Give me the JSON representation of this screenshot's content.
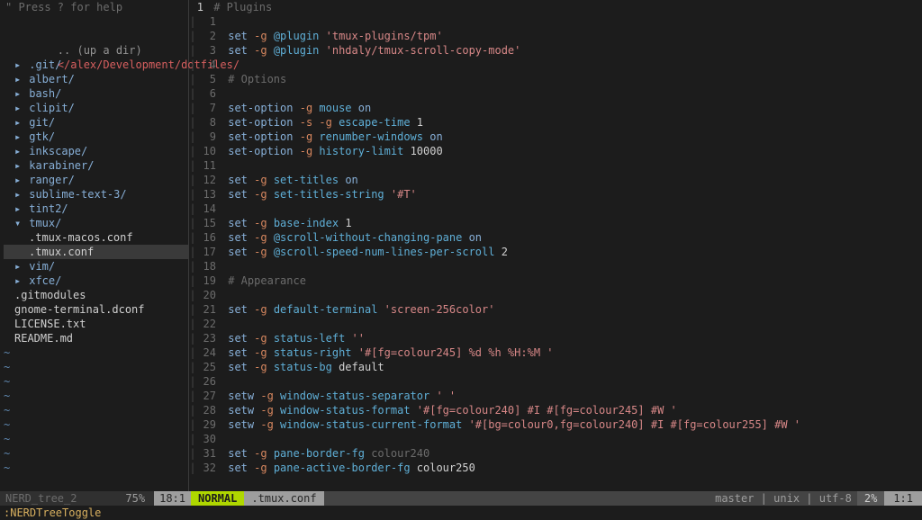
{
  "sidebar": {
    "help_hint": "\" Press ? for help",
    "up_dir": ".. (up a dir)",
    "root_path": "</alex/Development/dotfiles/",
    "items": [
      {
        "type": "dir",
        "name": ".git/",
        "open": false,
        "depth": 1
      },
      {
        "type": "dir",
        "name": "albert/",
        "open": false,
        "depth": 1
      },
      {
        "type": "dir",
        "name": "bash/",
        "open": false,
        "depth": 1
      },
      {
        "type": "dir",
        "name": "clipit/",
        "open": false,
        "depth": 1
      },
      {
        "type": "dir",
        "name": "git/",
        "open": false,
        "depth": 1
      },
      {
        "type": "dir",
        "name": "gtk/",
        "open": false,
        "depth": 1
      },
      {
        "type": "dir",
        "name": "inkscape/",
        "open": false,
        "depth": 1
      },
      {
        "type": "dir",
        "name": "karabiner/",
        "open": false,
        "depth": 1
      },
      {
        "type": "dir",
        "name": "ranger/",
        "open": false,
        "depth": 1
      },
      {
        "type": "dir",
        "name": "sublime-text-3/",
        "open": false,
        "depth": 1
      },
      {
        "type": "dir",
        "name": "tint2/",
        "open": false,
        "depth": 1
      },
      {
        "type": "dir",
        "name": "tmux/",
        "open": true,
        "depth": 1
      },
      {
        "type": "file",
        "name": ".tmux-macos.conf",
        "depth": 2,
        "selected": false
      },
      {
        "type": "file",
        "name": ".tmux.conf",
        "depth": 2,
        "selected": true
      },
      {
        "type": "dir",
        "name": "vim/",
        "open": false,
        "depth": 1
      },
      {
        "type": "dir",
        "name": "xfce/",
        "open": false,
        "depth": 1
      },
      {
        "type": "file",
        "name": ".gitmodules",
        "depth": 1
      },
      {
        "type": "file",
        "name": "gnome-terminal.dconf",
        "depth": 1
      },
      {
        "type": "file",
        "name": "LICENSE.txt",
        "depth": 1
      },
      {
        "type": "file",
        "name": "README.md",
        "depth": 1
      }
    ],
    "status": {
      "name": "NERD_tree_2",
      "percent": "75%",
      "pos": "18:1"
    }
  },
  "editor": {
    "cursor_line_display": " 1 ",
    "lines": [
      {
        "n": "",
        "tokens": [
          [
            "c-comment",
            "# Plugins"
          ]
        ]
      },
      {
        "n": "1",
        "tokens": []
      },
      {
        "n": "2",
        "tokens": [
          [
            "c-cmd",
            "set "
          ],
          [
            "c-flag",
            "-g "
          ],
          [
            "c-key",
            "@plugin "
          ],
          [
            "c-str",
            "'tmux-plugins/tpm'"
          ]
        ]
      },
      {
        "n": "3",
        "tokens": [
          [
            "c-cmd",
            "set "
          ],
          [
            "c-flag",
            "-g "
          ],
          [
            "c-key",
            "@plugin "
          ],
          [
            "c-str",
            "'nhdaly/tmux-scroll-copy-mode'"
          ]
        ]
      },
      {
        "n": "4",
        "tokens": []
      },
      {
        "n": "5",
        "tokens": [
          [
            "c-comment",
            "# Options"
          ]
        ]
      },
      {
        "n": "6",
        "tokens": []
      },
      {
        "n": "7",
        "tokens": [
          [
            "c-cmd",
            "set-option "
          ],
          [
            "c-flag",
            "-g "
          ],
          [
            "c-key",
            "mouse "
          ],
          [
            "c-on",
            "on"
          ]
        ]
      },
      {
        "n": "8",
        "tokens": [
          [
            "c-cmd",
            "set-option "
          ],
          [
            "c-flag",
            "-s -g "
          ],
          [
            "c-key",
            "escape-time "
          ],
          [
            "c-num",
            "1"
          ]
        ]
      },
      {
        "n": "9",
        "tokens": [
          [
            "c-cmd",
            "set-option "
          ],
          [
            "c-flag",
            "-g "
          ],
          [
            "c-key",
            "renumber-windows "
          ],
          [
            "c-on",
            "on"
          ]
        ]
      },
      {
        "n": "10",
        "tokens": [
          [
            "c-cmd",
            "set-option "
          ],
          [
            "c-flag",
            "-g "
          ],
          [
            "c-key",
            "history-limit "
          ],
          [
            "c-num",
            "10000"
          ]
        ]
      },
      {
        "n": "11",
        "tokens": []
      },
      {
        "n": "12",
        "tokens": [
          [
            "c-cmd",
            "set "
          ],
          [
            "c-flag",
            "-g "
          ],
          [
            "c-key",
            "set-titles "
          ],
          [
            "c-on",
            "on"
          ]
        ]
      },
      {
        "n": "13",
        "tokens": [
          [
            "c-cmd",
            "set "
          ],
          [
            "c-flag",
            "-g "
          ],
          [
            "c-key",
            "set-titles-string "
          ],
          [
            "c-str",
            "'#T'"
          ]
        ]
      },
      {
        "n": "14",
        "tokens": []
      },
      {
        "n": "15",
        "tokens": [
          [
            "c-cmd",
            "set "
          ],
          [
            "c-flag",
            "-g "
          ],
          [
            "c-key",
            "base-index "
          ],
          [
            "c-num",
            "1"
          ]
        ]
      },
      {
        "n": "16",
        "tokens": [
          [
            "c-cmd",
            "set "
          ],
          [
            "c-flag",
            "-g "
          ],
          [
            "c-key",
            "@scroll-without-changing-pane "
          ],
          [
            "c-on",
            "on"
          ]
        ]
      },
      {
        "n": "17",
        "tokens": [
          [
            "c-cmd",
            "set "
          ],
          [
            "c-flag",
            "-g "
          ],
          [
            "c-key",
            "@scroll-speed-num-lines-per-scroll "
          ],
          [
            "c-num",
            "2"
          ]
        ]
      },
      {
        "n": "18",
        "tokens": []
      },
      {
        "n": "19",
        "tokens": [
          [
            "c-comment",
            "# Appearance"
          ]
        ]
      },
      {
        "n": "20",
        "tokens": []
      },
      {
        "n": "21",
        "tokens": [
          [
            "c-cmd",
            "set "
          ],
          [
            "c-flag",
            "-g "
          ],
          [
            "c-key",
            "default-terminal "
          ],
          [
            "c-str",
            "'screen-256color'"
          ]
        ]
      },
      {
        "n": "22",
        "tokens": []
      },
      {
        "n": "23",
        "tokens": [
          [
            "c-cmd",
            "set "
          ],
          [
            "c-flag",
            "-g "
          ],
          [
            "c-key",
            "status-left "
          ],
          [
            "c-str",
            "''"
          ]
        ]
      },
      {
        "n": "24",
        "tokens": [
          [
            "c-cmd",
            "set "
          ],
          [
            "c-flag",
            "-g "
          ],
          [
            "c-key",
            "status-right "
          ],
          [
            "c-str",
            "'#[fg=colour245] %d %h %H:%M '"
          ]
        ]
      },
      {
        "n": "25",
        "tokens": [
          [
            "c-cmd",
            "set "
          ],
          [
            "c-flag",
            "-g "
          ],
          [
            "c-key",
            "status-bg "
          ],
          [
            "c-num",
            "default"
          ]
        ]
      },
      {
        "n": "26",
        "tokens": []
      },
      {
        "n": "27",
        "tokens": [
          [
            "c-cmd",
            "setw "
          ],
          [
            "c-flag",
            "-g "
          ],
          [
            "c-key",
            "window-status-separator "
          ],
          [
            "c-str",
            "' '"
          ]
        ]
      },
      {
        "n": "28",
        "tokens": [
          [
            "c-cmd",
            "setw "
          ],
          [
            "c-flag",
            "-g "
          ],
          [
            "c-key",
            "window-status-format "
          ],
          [
            "c-str",
            "'#[fg=colour240] #I #[fg=colour245] #W '"
          ]
        ]
      },
      {
        "n": "29",
        "tokens": [
          [
            "c-cmd",
            "setw "
          ],
          [
            "c-flag",
            "-g "
          ],
          [
            "c-key",
            "window-status-current-format "
          ],
          [
            "c-str",
            "'#[bg=colour0,fg=colour240] #I #[fg=colour255] #W '"
          ]
        ]
      },
      {
        "n": "30",
        "tokens": []
      },
      {
        "n": "31",
        "tokens": [
          [
            "c-cmd",
            "set "
          ],
          [
            "c-flag",
            "-g "
          ],
          [
            "c-key",
            "pane-border-fg "
          ],
          [
            "c-dim",
            "colour240"
          ]
        ]
      },
      {
        "n": "32",
        "tokens": [
          [
            "c-cmd",
            "set "
          ],
          [
            "c-flag",
            "-g "
          ],
          [
            "c-key",
            "pane-active-border-fg "
          ],
          [
            "c-num",
            "colour250"
          ]
        ]
      }
    ],
    "status": {
      "mode": "NORMAL",
      "file": ".tmux.conf",
      "branch": "master",
      "format": "unix",
      "encoding": "utf-8",
      "percent": "2%",
      "pos": "1:1"
    }
  },
  "cmdline": ":NERDTreeToggle"
}
